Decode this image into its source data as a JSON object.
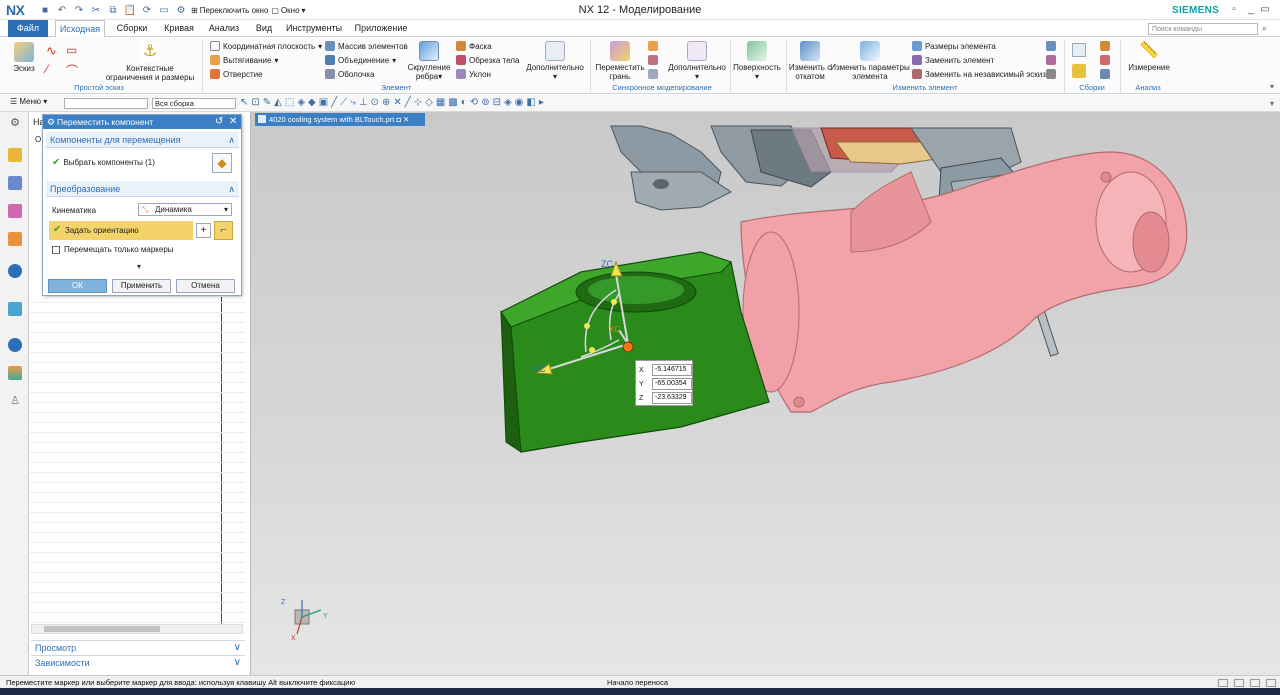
{
  "titlebar": {
    "app_logo": "NX",
    "window_title": "NX 12 - Моделирование",
    "brand": "SIEMENS",
    "switch_window": "Переключить окно",
    "window_menu": "Окно"
  },
  "menubar": {
    "tabs": [
      "Файл",
      "Исходная",
      "Сборки",
      "Кривая",
      "Анализ",
      "Вид",
      "Инструменты",
      "Приложение"
    ],
    "search_placeholder": "Поиск команды"
  },
  "ribbon": {
    "sketch": "Эскиз",
    "context_constraints": "Контекстные ограничения и размеры",
    "group_simple_sketch": "Простой эскиз",
    "coord_plane": "Координатная плоскость",
    "extrude": "Вытягивание",
    "hole": "Отверстие",
    "pattern": "Массив элементов",
    "unite": "Объединение",
    "shell": "Оболочка",
    "blend": "Скругление ребра",
    "chamfer": "Фаска",
    "trim_body": "Обрезка тела",
    "draft": "Уклон",
    "more": "Дополнительно",
    "group_feature": "Элемент",
    "move_face": "Переместить грань",
    "more2": "Дополнительно",
    "group_sync": "Синхронное моделирование",
    "surface": "Поверхность",
    "edit_rollback": "Изменить с откатом",
    "edit_params": "Изменить параметры элемента",
    "feature_dims": "Размеры элемента",
    "replace_feature": "Заменить элемент",
    "replace_sketch": "Заменить на независимый эскиз",
    "group_edit_feature": "Изменить элемент",
    "group_assemblies": "Сборки",
    "measure": "Измерение",
    "group_analysis": "Анализ"
  },
  "toolbar2": {
    "menu": "Меню",
    "filter_value": "",
    "assembly_scope": "Вся сборка"
  },
  "navigator": {
    "header_partial": "На",
    "column_partial": "О",
    "footer_preview": "Просмотр",
    "footer_dependencies": "Зависимости"
  },
  "dialog": {
    "title": "Переместить компонент",
    "section_components": "Компоненты для перемещения",
    "select_components": "Выбрать компоненты (1)",
    "section_transform": "Преобразование",
    "motion_label": "Кинематика",
    "motion_value": "Динамика",
    "specify_orientation": "Задать ориентацию",
    "move_handles_only": "Перемещать только маркеры",
    "ok": "ОК",
    "apply": "Применить",
    "cancel": "Отмена"
  },
  "viewport": {
    "tab_title": "4020 cooling system with BLTouch.prt",
    "axis_zc": "ZC",
    "axis_yc": "YC",
    "axis_xc": "XC",
    "triad_z": "Z",
    "triad_y": "Y",
    "triad_x": "X",
    "coord_x_label": "X",
    "coord_y_label": "Y",
    "coord_z_label": "Z",
    "coord_x": "-5.146715",
    "coord_y": "-65.00354",
    "coord_z": "-23.63329"
  },
  "status": {
    "prompt": "Переместите маркер или выберите маркер для ввода: используя клавишу Alt выключите фиксацию",
    "state": "Начало переноса"
  },
  "colors": {
    "accent": "#2d6fb7",
    "selected_part": "#2a8a1a",
    "pink_part": "#f2a3a8",
    "gray_part": "#8e9aa3"
  }
}
